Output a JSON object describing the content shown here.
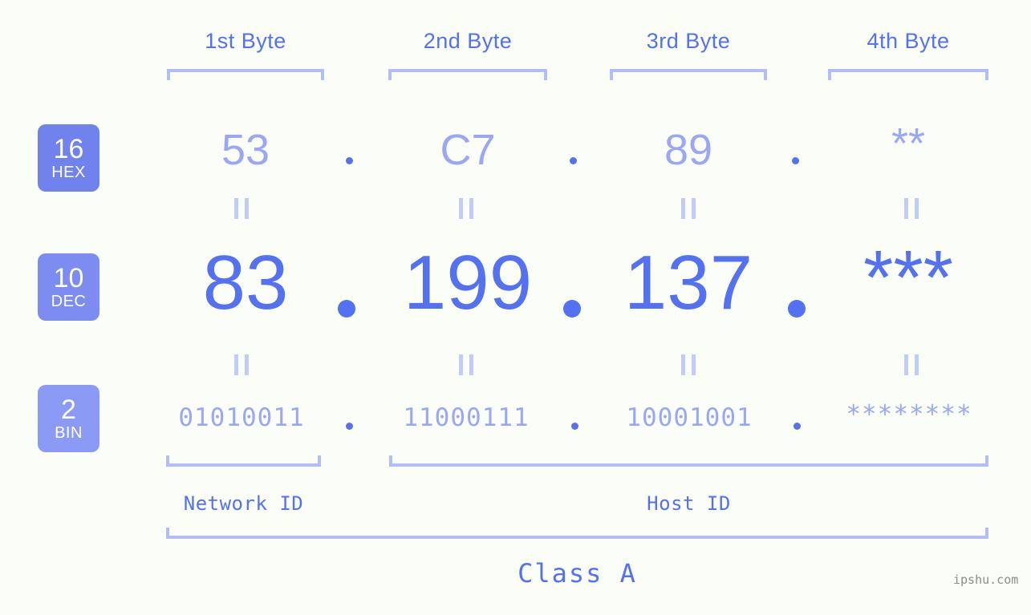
{
  "background_color": "#fbfdf7",
  "accent_color": "#5371f0",
  "accent_light_color": "#9aa7f5",
  "bracket_color": "#b3bdfa",
  "byte_headers": [
    {
      "label": "1st Byte"
    },
    {
      "label": "2nd Byte"
    },
    {
      "label": "3rd Byte"
    },
    {
      "label": "4th Byte"
    }
  ],
  "rows": {
    "hex": {
      "badge_number": "16",
      "badge_name": "HEX",
      "badge_color": "#7083ec",
      "values": [
        "53",
        "C7",
        "89",
        "**"
      ],
      "separator": "."
    },
    "dec": {
      "badge_number": "10",
      "badge_name": "DEC",
      "badge_color": "#7d8cf0",
      "values": [
        "83",
        "199",
        "137",
        "***"
      ],
      "separator": "."
    },
    "bin": {
      "badge_number": "2",
      "badge_name": "BIN",
      "badge_color": "#8b9bf5",
      "values": [
        "01010011",
        "11000111",
        "10001001",
        "********"
      ],
      "separator": "."
    }
  },
  "equality_marks": {
    "symbol": "=",
    "count_per_gap": 4
  },
  "segments": {
    "network_id": "Network ID",
    "host_id": "Host ID",
    "class": "Class A"
  },
  "watermark": "ipshu.com"
}
